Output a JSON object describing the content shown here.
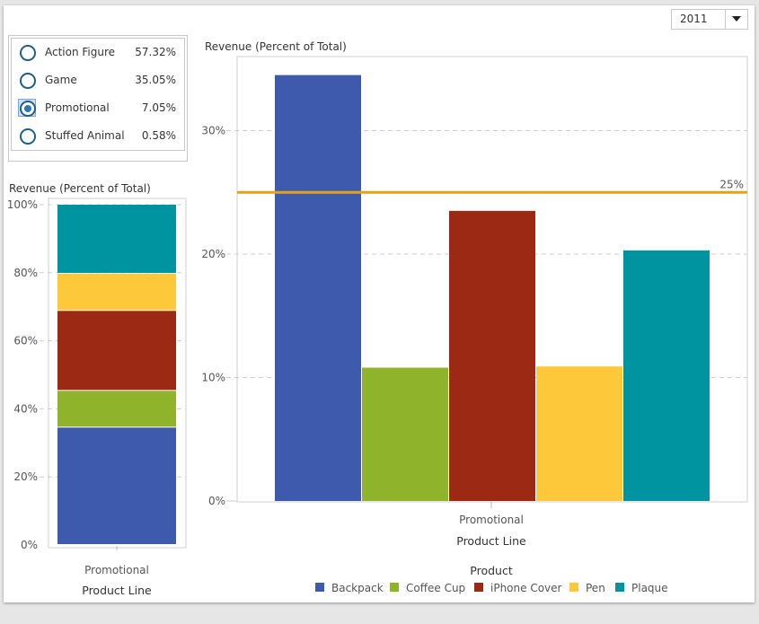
{
  "year_filter": {
    "selected": "2011",
    "icon": "triangle-down-icon"
  },
  "product_line_selector": {
    "items": [
      {
        "label": "Action Figure",
        "percent": "57.32%",
        "selected": false
      },
      {
        "label": "Game",
        "percent": "35.05%",
        "selected": false
      },
      {
        "label": "Promotional",
        "percent": "7.05%",
        "selected": true
      },
      {
        "label": "Stuffed Animal",
        "percent": "0.58%",
        "selected": false
      }
    ]
  },
  "colors": {
    "Backpack": "#3d5aad",
    "Coffee Cup": "#8fb32b",
    "iPhone Cover": "#9c2913",
    "Pen": "#fdc93a",
    "Plaque": "#0093a0",
    "reference_line": "#e6a11c"
  },
  "chart_data": [
    {
      "type": "bar",
      "stacked": true,
      "title": "Revenue (Percent of Total)",
      "xlabel": "Product Line",
      "ylabel": "",
      "categories": [
        "Promotional"
      ],
      "series": [
        {
          "name": "Backpack",
          "values": [
            34.5
          ]
        },
        {
          "name": "Coffee Cup",
          "values": [
            10.8
          ]
        },
        {
          "name": "iPhone Cover",
          "values": [
            23.5
          ]
        },
        {
          "name": "Pen",
          "values": [
            10.9
          ]
        },
        {
          "name": "Plaque",
          "values": [
            20.3
          ]
        }
      ],
      "ylim": [
        0,
        100
      ],
      "yticks": [
        0,
        20,
        40,
        60,
        80,
        100
      ],
      "ytick_labels": [
        "0%",
        "20%",
        "40%",
        "60%",
        "80%",
        "100%"
      ],
      "grid": true
    },
    {
      "type": "bar",
      "stacked": false,
      "title": "Revenue (Percent of Total)",
      "xlabel": "Product Line",
      "ylabel": "",
      "categories": [
        "Promotional"
      ],
      "series": [
        {
          "name": "Backpack",
          "values": [
            34.5
          ]
        },
        {
          "name": "Coffee Cup",
          "values": [
            10.8
          ]
        },
        {
          "name": "iPhone Cover",
          "values": [
            23.5
          ]
        },
        {
          "name": "Pen",
          "values": [
            10.9
          ]
        },
        {
          "name": "Plaque",
          "values": [
            20.3
          ]
        }
      ],
      "ylim": [
        0,
        36.4
      ],
      "yticks": [
        0,
        10,
        20,
        30
      ],
      "ytick_labels": [
        "0%",
        "10%",
        "20%",
        "30%"
      ],
      "reference_line": {
        "value": 25,
        "label": "25%"
      },
      "grid": true,
      "legend": {
        "title": "Product",
        "position": "bottom",
        "entries": [
          "Backpack",
          "Coffee Cup",
          "iPhone Cover",
          "Pen",
          "Plaque"
        ]
      }
    }
  ]
}
